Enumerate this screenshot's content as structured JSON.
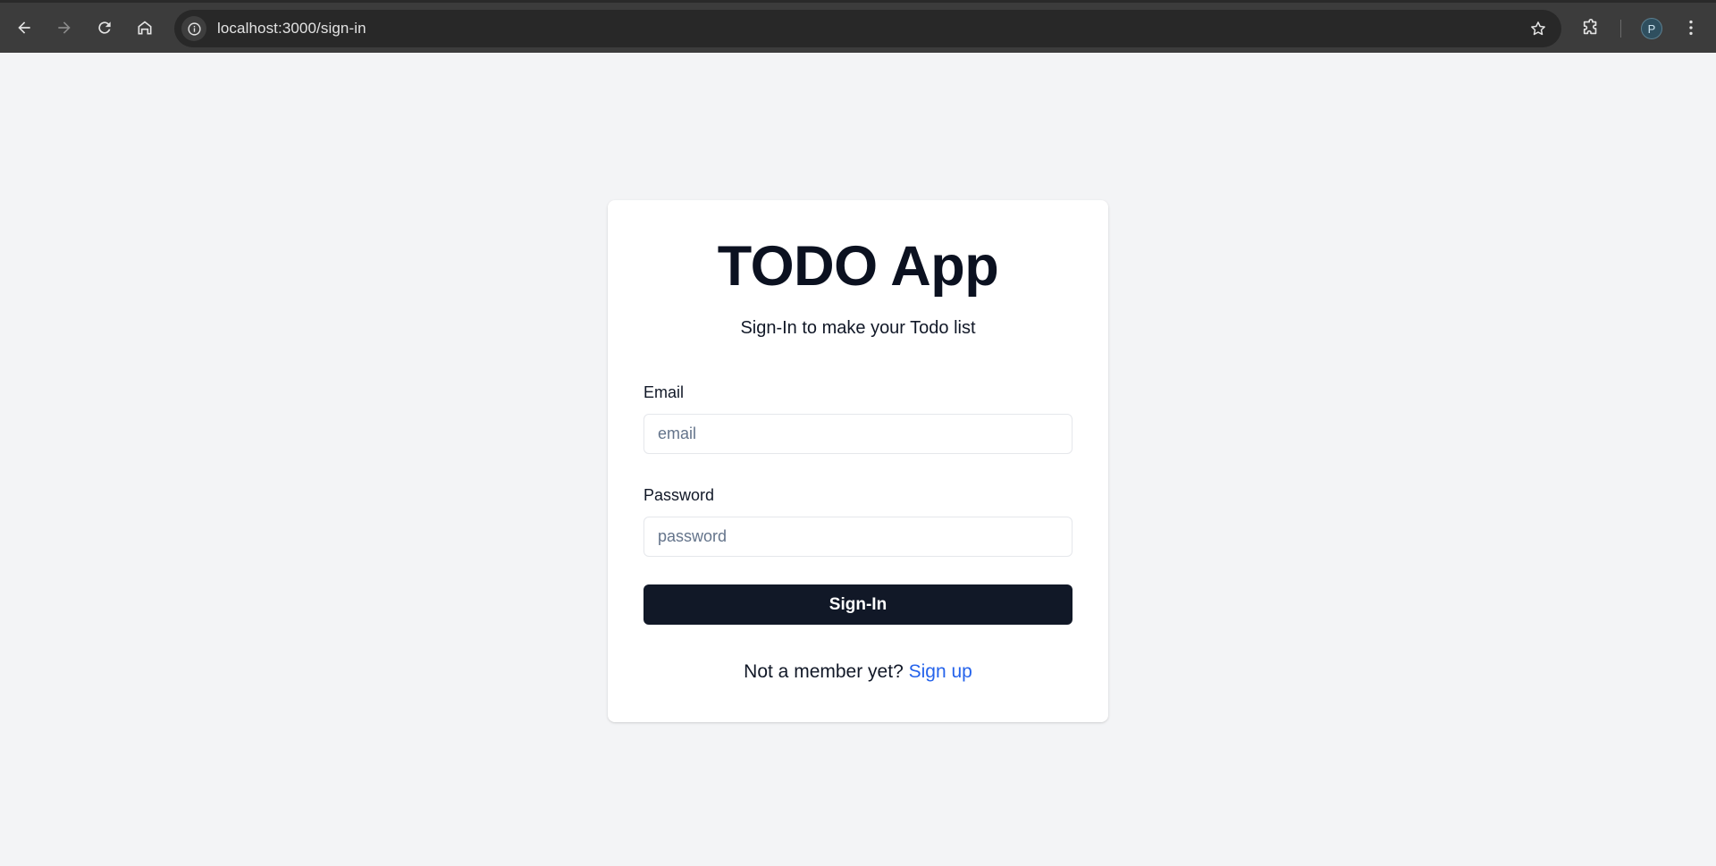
{
  "browser": {
    "url": "localhost:3000/sign-in",
    "profile_initial": "P"
  },
  "app": {
    "title": "TODO App",
    "subtitle": "Sign-In to make your Todo list",
    "email": {
      "label": "Email",
      "placeholder": "email",
      "value": ""
    },
    "password": {
      "label": "Password",
      "placeholder": "password",
      "value": ""
    },
    "submit_label": "Sign-In",
    "footer": {
      "prompt": "Not a member yet?",
      "link_label": "Sign up"
    }
  },
  "colors": {
    "page_bg": "#f3f4f6",
    "card_bg": "#ffffff",
    "button_bg": "#111827",
    "link": "#2563eb",
    "chrome_bg": "#3c3c3c"
  }
}
